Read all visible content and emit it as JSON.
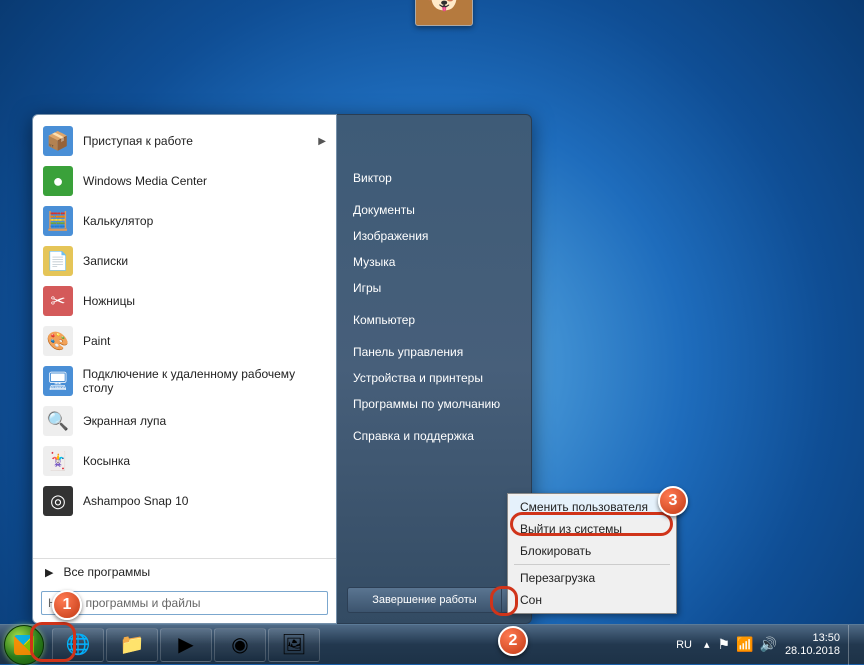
{
  "programs": [
    {
      "label": "Приступая к работе",
      "icon": "📦",
      "cls": "ic-blue",
      "arrow": true
    },
    {
      "label": "Windows Media Center",
      "icon": "●",
      "cls": "ic-green"
    },
    {
      "label": "Калькулятор",
      "icon": "🧮",
      "cls": "ic-blue"
    },
    {
      "label": "Записки",
      "icon": "📄",
      "cls": "ic-yellow"
    },
    {
      "label": "Ножницы",
      "icon": "✂",
      "cls": "ic-red"
    },
    {
      "label": "Paint",
      "icon": "🎨",
      "cls": "ic-white"
    },
    {
      "label": "Подключение к удаленному рабочему столу",
      "icon": "🖥",
      "cls": "ic-blue"
    },
    {
      "label": "Экранная лупа",
      "icon": "🔍",
      "cls": "ic-white"
    },
    {
      "label": "Косынка",
      "icon": "🃏",
      "cls": "ic-white"
    },
    {
      "label": "Ashampoo Snap 10",
      "icon": "◎",
      "cls": "ic-dark"
    }
  ],
  "all_programs": "Все программы",
  "search_placeholder": "Найти программы и файлы",
  "right_items": [
    "Виктор",
    "Документы",
    "Изображения",
    "Музыка",
    "Игры",
    "Компьютер",
    "Панель управления",
    "Устройства и принтеры",
    "Программы по умолчанию",
    "Справка и поддержка"
  ],
  "shutdown_label": "Завершение работы",
  "shutdown_menu": [
    "Сменить пользователя",
    "Выйти из системы",
    "Блокировать",
    "Перезагрузка",
    "Сон"
  ],
  "tray": {
    "lang": "RU",
    "time": "13:50",
    "date": "28.10.2018"
  },
  "steps": {
    "1": "1",
    "2": "2",
    "3": "3"
  }
}
